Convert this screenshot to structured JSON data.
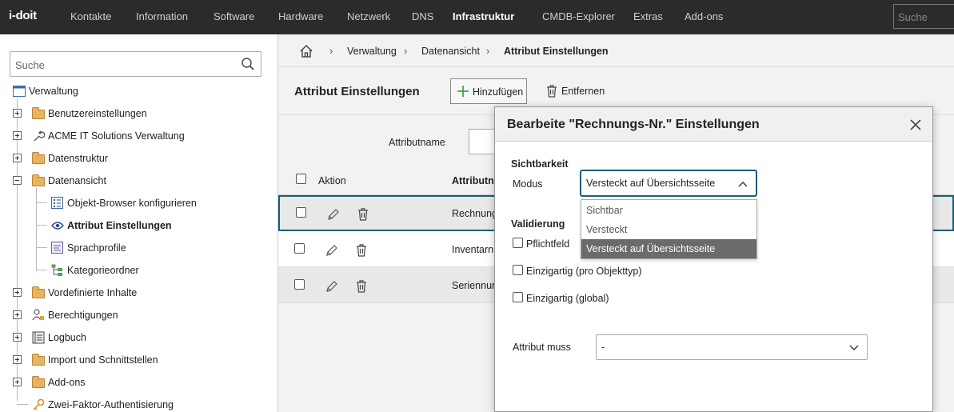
{
  "app": {
    "logo": "i-doit"
  },
  "topnav": {
    "items": [
      "Kontakte",
      "Information",
      "Software",
      "Hardware",
      "Netzwerk",
      "DNS",
      "Infrastruktur",
      "CMDB-Explorer",
      "Extras",
      "Add-ons"
    ],
    "active": "Infrastruktur",
    "search_placeholder": "Suche"
  },
  "sidebar": {
    "search_placeholder": "Suche",
    "root": "Verwaltung",
    "items": {
      "benutzer": "Benutzereinstellungen",
      "acme": "ACME IT Solutions Verwaltung",
      "datenstruktur": "Datenstruktur",
      "datenansicht": "Datenansicht",
      "objektbrowser": "Objekt-Browser konfigurieren",
      "attribut": "Attribut Einstellungen",
      "sprachprofile": "Sprachprofile",
      "kategorieordner": "Kategorieordner",
      "vordefiniert": "Vordefinierte Inhalte",
      "berechtigungen": "Berechtigungen",
      "logbuch": "Logbuch",
      "import": "Import und Schnittstellen",
      "addons": "Add-ons",
      "zweifaktor": "Zwei-Faktor-Authentisierung"
    }
  },
  "breadcrumb": {
    "items": [
      "Verwaltung",
      "Datenansicht",
      "Attribut Einstellungen"
    ]
  },
  "page": {
    "title": "Attribut Einstellungen",
    "add_label": "Hinzufügen",
    "remove_label": "Entfernen",
    "filter_label": "Attributname"
  },
  "table": {
    "col_action": "Aktion",
    "col_attribute": "Attributn",
    "rows": [
      "Rechnung",
      "Inventarnu",
      "Seriennum"
    ]
  },
  "dialog": {
    "title": "Bearbeite \"Rechnungs-Nr.\" Einstellungen",
    "visibility_heading": "Sichtbarkeit",
    "mode_label": "Modus",
    "mode_value": "Versteckt auf Übersichtsseite",
    "mode_options": [
      "Sichtbar",
      "Versteckt",
      "Versteckt auf Übersichtsseite"
    ],
    "validation_heading": "Validierung",
    "required_label": "Pflichtfeld",
    "unique_type_label": "Einzigartig (pro Objekttyp)",
    "unique_global_label": "Einzigartig (global)",
    "must_label": "Attribut muss",
    "must_value": "-"
  },
  "colors": {
    "topbar": "#2b2b2b",
    "accent": "#1c5e73",
    "selected_option": "#6b6b6b"
  }
}
